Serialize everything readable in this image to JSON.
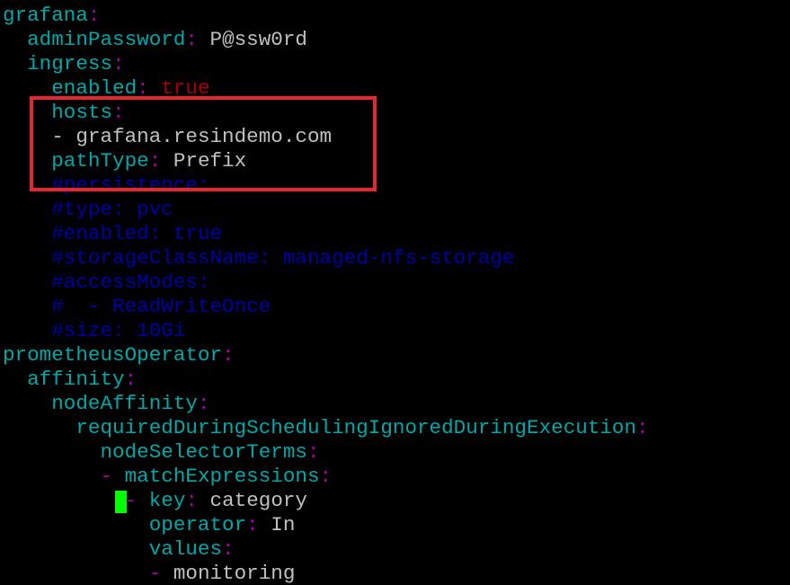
{
  "colors": {
    "background": "#000000",
    "key": "#00a8a8",
    "punctuation": "#a800a8",
    "value": "#c0c0c0",
    "boolean": "#a80000",
    "comment": "#0000a8",
    "highlight_box": "#e8262d",
    "cursor": "#00ff00"
  },
  "lines": [
    {
      "key": "grafana",
      "colon": ":"
    },
    {
      "key": "adminPassword",
      "colon": ":",
      "value": " P@ssw0rd"
    },
    {
      "key": "ingress",
      "colon": ":"
    },
    {
      "key": "enabled",
      "colon": ":",
      "value": " true"
    },
    {
      "key": "hosts",
      "colon": ":"
    },
    {
      "dash": "- ",
      "value": "grafana.resindemo.com"
    },
    {
      "key": "pathType",
      "colon": ":",
      "value": " Prefix"
    },
    {
      "comment": "#persistence:"
    },
    {
      "comment": "#type: pvc"
    },
    {
      "comment": "#enabled: true"
    },
    {
      "comment": "#storageClassName: managed-nfs-storage"
    },
    {
      "comment": "#accessModes:"
    },
    {
      "comment": "#  - ReadWriteOnce"
    },
    {
      "comment": "#size: 10Gi"
    },
    {
      "key": "prometheusOperator",
      "colon": ":"
    },
    {
      "key": "affinity",
      "colon": ":"
    },
    {
      "key": "nodeAffinity",
      "colon": ":"
    },
    {
      "key": "requiredDuringSchedulingIgnoredDuringExecution",
      "colon": ":"
    },
    {
      "key": "nodeSelectorTerms",
      "colon": ":"
    },
    {
      "dash": "- ",
      "key": "matchExpressions",
      "colon": ":"
    },
    {
      "dash": "- ",
      "key": "key",
      "colon": ":",
      "value": " category"
    },
    {
      "key": "operator",
      "colon": ":",
      "value": " In"
    },
    {
      "key": "values",
      "colon": ":"
    },
    {
      "dash": "- ",
      "value": "monitoring"
    }
  ]
}
